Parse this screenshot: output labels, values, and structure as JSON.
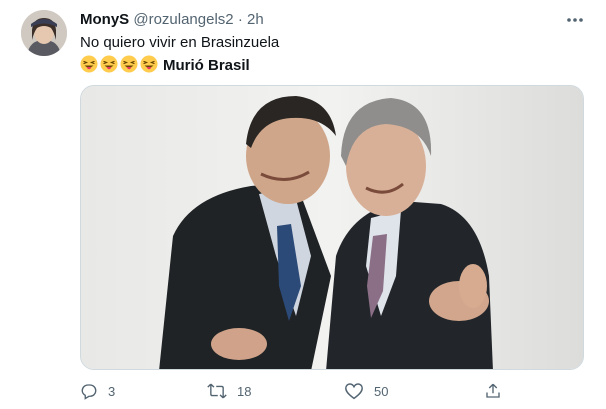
{
  "tweet": {
    "author_name": "MonyS",
    "author_handle": "@rozulangels2",
    "separator": "·",
    "time": "2h",
    "text_line1": "No quiero vivir en Brasinzuela",
    "emoji_count": 4,
    "text_bold": "Murió Brasil"
  },
  "actions": {
    "reply_count": "3",
    "retweet_count": "18",
    "like_count": "50"
  },
  "icons": [
    "avatar",
    "more-icon",
    "emoji-face",
    "reply-icon",
    "retweet-icon",
    "like-icon",
    "share-icon"
  ],
  "colors": {
    "text": "#0f1419",
    "secondary": "#536471",
    "border": "#cfd9de",
    "emoji": "#ffcc4d"
  }
}
